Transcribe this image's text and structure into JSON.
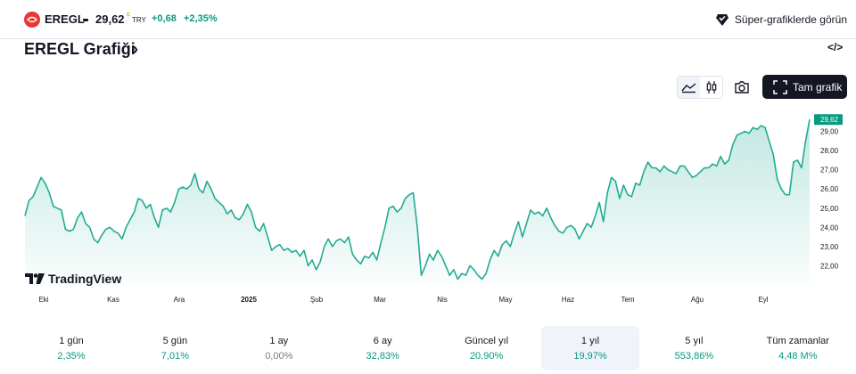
{
  "header": {
    "symbol": "EREGL",
    "price": "29,62",
    "price_marker": "c",
    "currency": "TRY",
    "change": "+0,68",
    "change_pct": "+2,35%",
    "super_charts_label": "Süper-grafiklerde görün"
  },
  "title": {
    "text": "EREGL Grafiği",
    "chevron": "›",
    "embed_icon": "</>"
  },
  "toolbar": {
    "area_icon": "area-chart-icon",
    "candle_icon": "candlestick-icon",
    "camera_icon": "camera-icon",
    "full_chart_label": "Tam grafik"
  },
  "brand": {
    "tradingview": "TradingView"
  },
  "colors": {
    "line": "#22ab94",
    "positive": "#089981",
    "neutral": "#787b86",
    "price_tag": "#089981"
  },
  "chart_data": {
    "type": "area",
    "x_ticks": [
      "Eki",
      "Kas",
      "Ara",
      "2025",
      "Şub",
      "Mar",
      "Nis",
      "May",
      "Haz",
      "Tem",
      "Ağu",
      "Eyl"
    ],
    "y_ticks": [
      "29,00",
      "28,00",
      "27,00",
      "26,00",
      "25,00",
      "24,00",
      "23,00",
      "22,00"
    ],
    "y_tick_values": [
      29,
      28,
      27,
      26,
      25,
      24,
      23,
      22
    ],
    "ylim": [
      21.0,
      30.0
    ],
    "last_price_label": "29,62",
    "last_price": 29.62,
    "values": [
      24.6,
      25.4,
      25.6,
      26.1,
      26.6,
      26.3,
      25.8,
      25.1,
      25.0,
      24.9,
      23.9,
      23.8,
      23.9,
      24.5,
      24.8,
      24.2,
      24.0,
      23.4,
      23.2,
      23.6,
      23.9,
      24.0,
      23.8,
      23.7,
      23.4,
      24.0,
      24.4,
      24.8,
      25.5,
      25.4,
      25.0,
      25.2,
      24.5,
      24.0,
      24.9,
      25.0,
      24.8,
      25.3,
      26.0,
      26.1,
      26.0,
      26.2,
      26.8,
      26.0,
      25.8,
      26.4,
      26.0,
      25.5,
      25.3,
      25.1,
      24.7,
      24.9,
      24.5,
      24.4,
      24.7,
      25.2,
      24.8,
      24.0,
      23.8,
      24.2,
      23.5,
      22.8,
      23.0,
      23.1,
      22.8,
      22.9,
      22.7,
      22.8,
      22.5,
      22.8,
      22.0,
      22.3,
      21.8,
      22.2,
      23.0,
      23.4,
      23.0,
      23.3,
      23.4,
      23.2,
      23.5,
      22.6,
      22.3,
      22.1,
      22.5,
      22.4,
      22.7,
      22.3,
      23.2,
      24.0,
      25.0,
      25.1,
      24.8,
      25.0,
      25.5,
      25.7,
      25.8,
      24.0,
      21.5,
      22.0,
      22.6,
      22.3,
      22.8,
      22.5,
      22.0,
      21.5,
      21.8,
      21.3,
      21.6,
      21.5,
      22.0,
      21.8,
      21.5,
      21.3,
      21.6,
      22.3,
      22.8,
      22.5,
      23.1,
      23.3,
      23.0,
      23.7,
      24.3,
      23.5,
      24.2,
      24.9,
      24.7,
      24.8,
      24.6,
      25.0,
      24.5,
      24.1,
      23.8,
      23.7,
      24.0,
      24.1,
      23.9,
      23.4,
      23.8,
      24.2,
      24.0,
      24.6,
      25.3,
      24.3,
      25.8,
      26.6,
      26.4,
      25.5,
      26.2,
      25.7,
      25.6,
      26.3,
      26.2,
      26.9,
      27.4,
      27.1,
      27.1,
      26.9,
      27.2,
      27.0,
      26.9,
      26.8,
      27.2,
      27.2,
      26.9,
      26.6,
      26.7,
      26.9,
      27.1,
      27.1,
      27.3,
      27.2,
      27.7,
      27.3,
      27.5,
      28.3,
      28.8,
      28.9,
      29.0,
      28.9,
      29.2,
      29.1,
      29.3,
      29.2,
      28.5,
      27.8,
      26.5,
      26.0,
      25.7,
      25.7,
      27.4,
      27.5,
      27.1,
      28.5,
      29.62
    ]
  },
  "periods": [
    {
      "label": "1 gün",
      "value": "2,35%",
      "status": "positive"
    },
    {
      "label": "5 gün",
      "value": "7,01%",
      "status": "positive"
    },
    {
      "label": "1 ay",
      "value": "0,00%",
      "status": "neutral"
    },
    {
      "label": "6 ay",
      "value": "32,83%",
      "status": "positive"
    },
    {
      "label": "Güncel yıl",
      "value": "20,90%",
      "status": "positive"
    },
    {
      "label": "1 yıl",
      "value": "19,97%",
      "status": "positive",
      "active": true
    },
    {
      "label": "5 yıl",
      "value": "553,86%",
      "status": "positive"
    },
    {
      "label": "Tüm zamanlar",
      "value": "4,48 M%",
      "status": "positive"
    }
  ]
}
